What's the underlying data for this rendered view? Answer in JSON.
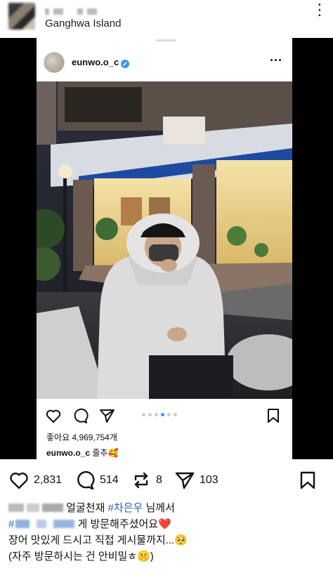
{
  "post_header": {
    "location": "Ganghwa Island",
    "more_icon": "more-vertical-icon"
  },
  "embedded_post": {
    "username": "eunwo.o_c",
    "verified_mark": "✔",
    "more_icon": "more-horizontal-icon",
    "carousel_pages": 6,
    "carousel_active": 3,
    "likes_text": "좋아요 4,969,754개",
    "caption_user": "eunwo.o_c",
    "caption_text": " 줄추",
    "caption_emoji": "🥰"
  },
  "action_bar": {
    "like_count": "2,831",
    "comment_count": "514",
    "repost_count": "8",
    "share_count": "103"
  },
  "caption": {
    "line1_text": " 얼굴천재 ",
    "line1_tag": "#차은우",
    "line1_end": " 님께서",
    "line2_hash": "#",
    "line2_text": " 게 방문해주셨어요",
    "line2_emoji": "❤️",
    "line3_text": "장어 맛있게 드시고 직접 게시물까지...",
    "line3_emoji": "🥺",
    "line4_text": "(자주 방문하시는 건 안비밀ㅎ",
    "line4_emoji": "🤫",
    "line4_end": ")"
  },
  "colors": {
    "accent_blue": "#3897f0",
    "hashtag": "#2a5db0",
    "heart": "#e0245e"
  }
}
